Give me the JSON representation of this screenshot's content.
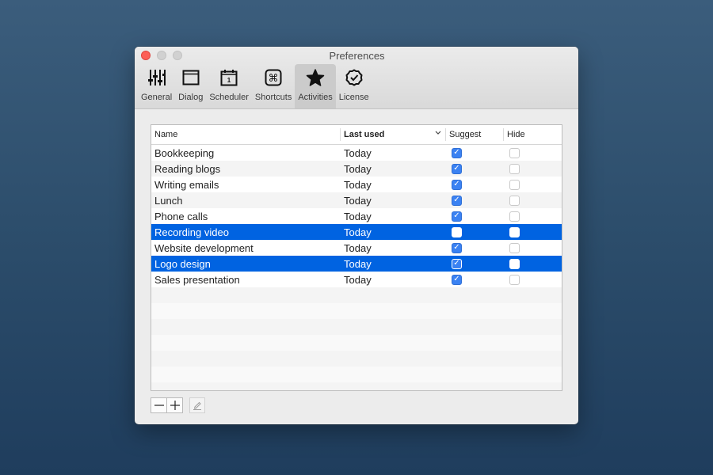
{
  "window": {
    "title": "Preferences"
  },
  "toolbar": {
    "items": [
      {
        "label": "General",
        "icon": "sliders-icon",
        "active": false
      },
      {
        "label": "Dialog",
        "icon": "window-icon",
        "active": false
      },
      {
        "label": "Scheduler",
        "icon": "calendar-icon",
        "active": false
      },
      {
        "label": "Shortcuts",
        "icon": "command-key-icon",
        "active": false
      },
      {
        "label": "Activities",
        "icon": "star-icon",
        "active": true
      },
      {
        "label": "License",
        "icon": "badge-check-icon",
        "active": false
      }
    ]
  },
  "table": {
    "columns": {
      "name": "Name",
      "last_used": "Last used",
      "suggest": "Suggest",
      "hide": "Hide"
    },
    "sort_indicator": "chevron-down",
    "rows": [
      {
        "name": "Bookkeeping",
        "last_used": "Today",
        "suggest": true,
        "hide": false,
        "selected": false
      },
      {
        "name": "Reading blogs",
        "last_used": "Today",
        "suggest": true,
        "hide": false,
        "selected": false
      },
      {
        "name": "Writing emails",
        "last_used": "Today",
        "suggest": true,
        "hide": false,
        "selected": false
      },
      {
        "name": "Lunch",
        "last_used": "Today",
        "suggest": true,
        "hide": false,
        "selected": false
      },
      {
        "name": "Phone calls",
        "last_used": "Today",
        "suggest": true,
        "hide": false,
        "selected": false
      },
      {
        "name": "Recording video",
        "last_used": "Today",
        "suggest": false,
        "hide": false,
        "selected": true
      },
      {
        "name": "Website development",
        "last_used": "Today",
        "suggest": true,
        "hide": false,
        "selected": false
      },
      {
        "name": "Logo design",
        "last_used": "Today",
        "suggest": true,
        "hide": false,
        "selected": true
      },
      {
        "name": "Sales presentation",
        "last_used": "Today",
        "suggest": true,
        "hide": false,
        "selected": false
      }
    ]
  },
  "buttons": {
    "remove": "−",
    "add": "+",
    "edit_icon": "pencil-icon"
  },
  "colors": {
    "selection": "#0063e1",
    "checkbox": "#3b82f2",
    "close": "#fc5f57"
  }
}
